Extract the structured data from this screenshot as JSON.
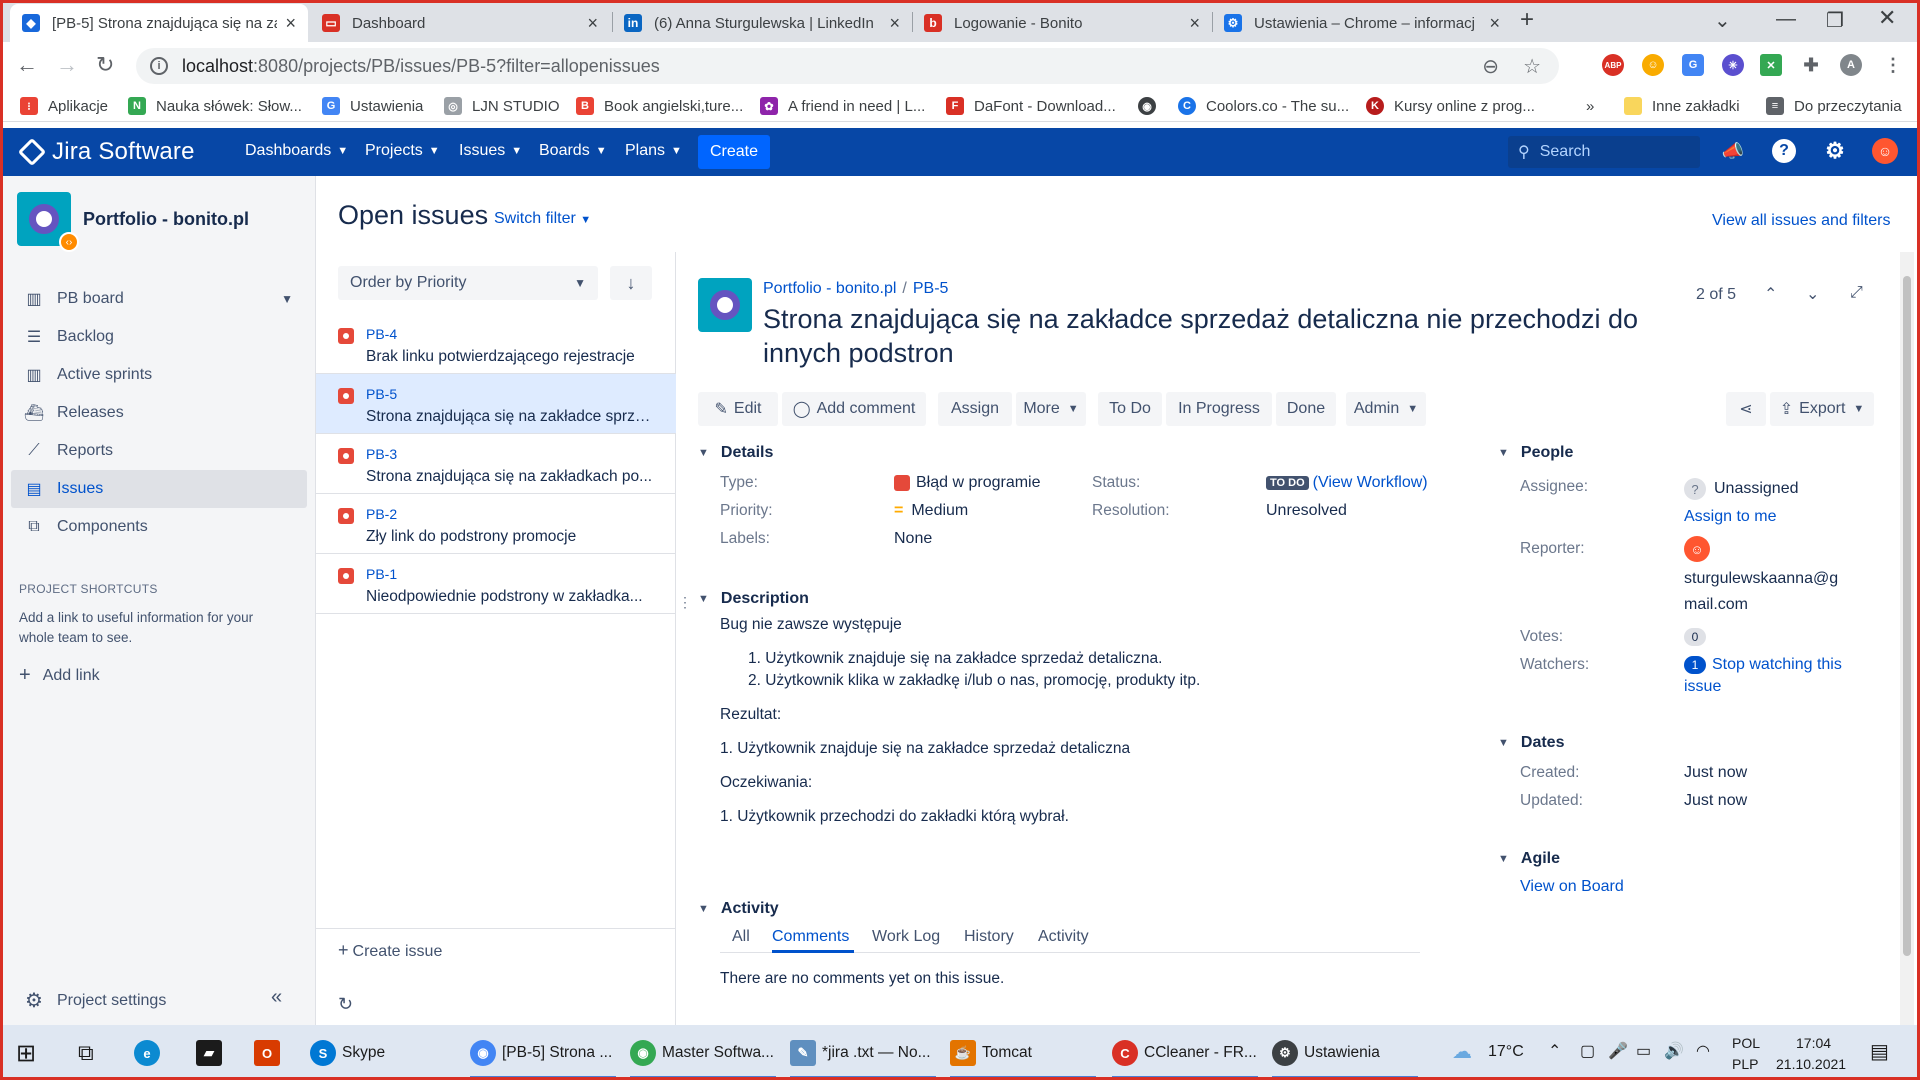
{
  "browser": {
    "tabs": [
      {
        "title": "[PB-5] Strona znajdująca się na za",
        "color": "#1868DB",
        "icon": "jira-icon",
        "active": true
      },
      {
        "title": "Dashboard",
        "color": "#d93025",
        "icon": "dashboard-icon",
        "active": false
      },
      {
        "title": "(6) Anna Sturgulewska | LinkedIn",
        "color": "#0A66C2",
        "icon": "linkedin-icon",
        "active": false
      },
      {
        "title": "Logowanie - Bonito",
        "color": "#d93025",
        "icon": "bonito-icon",
        "active": false
      },
      {
        "title": "Ustawienia – Chrome – informacj",
        "color": "#1a73e8",
        "icon": "gear-icon",
        "active": false
      }
    ],
    "url_host": "localhost",
    "url_rest": ":8080/projects/PB/issues/PB-5?filter=allopenissues",
    "bookmarks": [
      {
        "label": "Aplikacje",
        "color": "#ea4335"
      },
      {
        "label": "Nauka słówek: Słow...",
        "color": "#34a853"
      },
      {
        "label": "Ustawienia",
        "color": "#4285f4"
      },
      {
        "label": "LJN STUDIO",
        "color": "#9aa0a6"
      },
      {
        "label": "Book angielski,ture...",
        "color": "#ea4335"
      },
      {
        "label": "A friend in need | L...",
        "color": "#8e24aa"
      },
      {
        "label": "DaFont - Download...",
        "color": "#d93025"
      },
      {
        "label": "",
        "color": "#3c4043"
      },
      {
        "label": "Coolors.co - The su...",
        "color": "#1a73e8"
      },
      {
        "label": "Kursy online z prog...",
        "color": "#b71c1c"
      }
    ],
    "bookmarks_more": "»",
    "other_bookmarks": "Inne zakładki",
    "reading_list": "Do przeczytania",
    "profile_letter": "A"
  },
  "jira": {
    "brand": "Jira Software",
    "menu": [
      "Dashboards",
      "Projects",
      "Issues",
      "Boards",
      "Plans"
    ],
    "create": "Create",
    "search_placeholder": "Search"
  },
  "sidebar": {
    "project_name": "Portfolio - bonito.pl",
    "board": "PB board",
    "items": [
      {
        "label": "Backlog",
        "icon": "backlog-icon"
      },
      {
        "label": "Active sprints",
        "icon": "board-icon"
      },
      {
        "label": "Releases",
        "icon": "ship-icon"
      },
      {
        "label": "Reports",
        "icon": "chart-icon"
      },
      {
        "label": "Issues",
        "icon": "issues-icon",
        "selected": true
      },
      {
        "label": "Components",
        "icon": "component-icon"
      }
    ],
    "shortcuts_heading": "PROJECT SHORTCUTS",
    "shortcuts_note": "Add a link to useful information for your whole team to see.",
    "add_link": "Add link",
    "settings": "Project settings"
  },
  "page": {
    "title": "Open issues",
    "switch_filter": "Switch filter",
    "view_all": "View all issues and filters"
  },
  "issue_list": {
    "order_by": "Order by Priority",
    "issues": [
      {
        "key": "PB-4",
        "summary": "Brak linku potwierdzającego rejestracje",
        "selected": false
      },
      {
        "key": "PB-5",
        "summary": "Strona znajdująca się na zakładce sprze...",
        "selected": true
      },
      {
        "key": "PB-3",
        "summary": "Strona znajdująca się na zakładkach po...",
        "selected": false
      },
      {
        "key": "PB-2",
        "summary": "Zły link do podstrony promocje",
        "selected": false
      },
      {
        "key": "PB-1",
        "summary": "Nieodpowiednie podstrony w zakładka...",
        "selected": false
      }
    ],
    "create_issue": "Create issue"
  },
  "issue": {
    "project": "Portfolio - bonito.pl",
    "key": "PB-5",
    "title": "Strona znajdująca się na zakładce sprzedaż detaliczna nie przechodzi do innych podstron",
    "pager": "2 of 5",
    "actions": {
      "edit": "Edit",
      "comment": "Add comment",
      "assign": "Assign",
      "more": "More",
      "todo": "To Do",
      "in_progress": "In Progress",
      "done": "Done",
      "admin": "Admin",
      "export": "Export"
    },
    "details": {
      "heading": "Details",
      "type_label": "Type:",
      "type": "Błąd w programie",
      "priority_label": "Priority:",
      "priority": "Medium",
      "labels_label": "Labels:",
      "labels": "None",
      "status_label": "Status:",
      "status": "TO DO",
      "workflow_open": "(",
      "view_workflow": "View Workflow",
      "workflow_close": ")",
      "resolution_label": "Resolution:",
      "resolution": "Unresolved"
    },
    "description": {
      "heading": "Description",
      "intro": "Bug nie zawsze występuje",
      "steps": [
        "1. Użytkownik znajduje się na zakładce sprzedaż detaliczna.",
        "2. Użytkownik klika w zakładkę i/lub o nas, promocję, produkty itp."
      ],
      "result_label": "Rezultat:",
      "result": "1. Użytkownik znajduje się na zakładce sprzedaż detaliczna",
      "expected_label": "Oczekiwania:",
      "expected": "1. Użytkownik przechodzi do zakładki którą wybrał."
    },
    "activity": {
      "heading": "Activity",
      "tabs": [
        "All",
        "Comments",
        "Work Log",
        "History",
        "Activity"
      ],
      "empty": "There are no comments yet on this issue."
    },
    "people": {
      "heading": "People",
      "assignee_label": "Assignee:",
      "assignee": "Unassigned",
      "assign_to_me": "Assign to me",
      "reporter_label": "Reporter:",
      "reporter_line1": "sturgulewskaanna@g",
      "reporter_line2": "mail.com",
      "votes_label": "Votes:",
      "votes": "0",
      "watchers_label": "Watchers:",
      "watchers": "1",
      "stop_watching_1": "Stop watching this",
      "stop_watching_2": "issue"
    },
    "dates": {
      "heading": "Dates",
      "created_label": "Created:",
      "created": "Just now",
      "updated_label": "Updated:",
      "updated": "Just now"
    },
    "agile": {
      "heading": "Agile",
      "view_on_board": "View on Board"
    }
  },
  "taskbar": {
    "items": [
      {
        "label": "Skype",
        "color": "#0078d4"
      },
      {
        "label": "[PB-5] Strona ...",
        "color": "#4285f4"
      },
      {
        "label": "Master Softwa...",
        "color": "#34a853"
      },
      {
        "label": "*jira .txt — No...",
        "color": "#5f8fbf"
      },
      {
        "label": "Tomcat",
        "color": "#e37400"
      },
      {
        "label": "CCleaner - FR...",
        "color": "#d93025"
      },
      {
        "label": "Ustawienia",
        "color": "#3c4043"
      }
    ],
    "temperature": "17°C",
    "lang1": "POL",
    "lang2": "PLP",
    "time": "17:04",
    "date": "21.10.2021"
  }
}
